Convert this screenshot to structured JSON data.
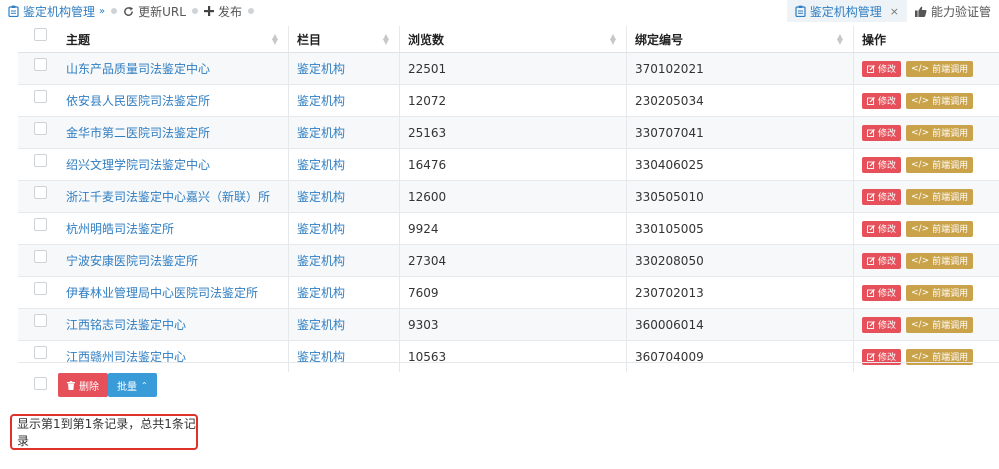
{
  "breadcrumb": {
    "current": "鉴定机构管理",
    "refresh": "更新URL",
    "publish": "发布"
  },
  "tabs": [
    {
      "label": "鉴定机构管理",
      "close": "×"
    },
    {
      "label": "能力验证管"
    }
  ],
  "table": {
    "headers": {
      "title": "主题",
      "column": "栏目",
      "views": "浏览数",
      "code": "绑定编号",
      "ops": "操作"
    },
    "rows": [
      {
        "title": "山东产品质量司法鉴定中心",
        "column": "鉴定机构",
        "views": "22501",
        "code": "370102021"
      },
      {
        "title": "依安县人民医院司法鉴定所",
        "column": "鉴定机构",
        "views": "12072",
        "code": "230205034"
      },
      {
        "title": "金华市第二医院司法鉴定所",
        "column": "鉴定机构",
        "views": "25163",
        "code": "330707041"
      },
      {
        "title": "绍兴文理学院司法鉴定中心",
        "column": "鉴定机构",
        "views": "16476",
        "code": "330406025"
      },
      {
        "title": "浙江千麦司法鉴定中心嘉兴（新联）所",
        "column": "鉴定机构",
        "views": "12600",
        "code": "330505010"
      },
      {
        "title": "杭州明皓司法鉴定所",
        "column": "鉴定机构",
        "views": "9924",
        "code": "330105005"
      },
      {
        "title": "宁波安康医院司法鉴定所",
        "column": "鉴定机构",
        "views": "27304",
        "code": "330208050"
      },
      {
        "title": "伊春林业管理局中心医院司法鉴定所",
        "column": "鉴定机构",
        "views": "7609",
        "code": "230702013"
      },
      {
        "title": "江西铭志司法鉴定中心",
        "column": "鉴定机构",
        "views": "9303",
        "code": "360006014"
      },
      {
        "title": "江西赣州司法鉴定中心",
        "column": "鉴定机构",
        "views": "10563",
        "code": "360704009"
      }
    ],
    "row_actions": {
      "edit": "修改",
      "frontend": "前端调用"
    }
  },
  "bulk": {
    "delete": "删除",
    "batch": "批量"
  },
  "pagination": {
    "summary": "显示第1到第1条记录，总共1条记录"
  },
  "colors": {
    "link": "#2f7ec2",
    "danger": "#e6505a",
    "gold": "#c9a24a",
    "primary": "#3a9bd9",
    "highlight": "#e0302a"
  },
  "icons": [
    "clipboard-icon",
    "chevron-double-down-icon",
    "refresh-icon",
    "plus-icon",
    "close-icon",
    "thumbs-up-icon",
    "edit-icon",
    "code-icon",
    "trash-icon",
    "caret-up-icon",
    "sort-icon"
  ]
}
